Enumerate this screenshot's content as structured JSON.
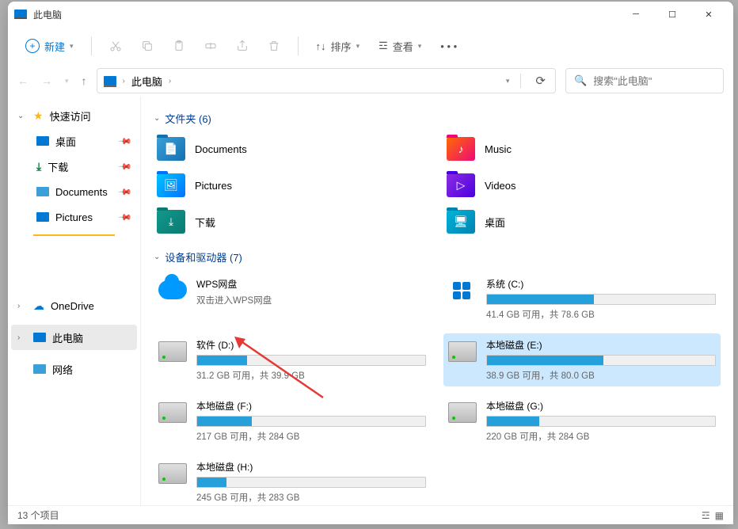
{
  "window": {
    "title": "此电脑"
  },
  "toolbar": {
    "new_label": "新建",
    "sort_label": "排序",
    "view_label": "查看"
  },
  "breadcrumb": {
    "location": "此电脑"
  },
  "search": {
    "placeholder": "搜索\"此电脑\""
  },
  "sidebar": {
    "quick_access": "快速访问",
    "items": [
      {
        "label": "桌面"
      },
      {
        "label": "下载"
      },
      {
        "label": "Documents"
      },
      {
        "label": "Pictures"
      }
    ],
    "onedrive": "OneDrive",
    "this_pc": "此电脑",
    "network": "网络"
  },
  "sections": {
    "folders_header": "文件夹 (6)",
    "drives_header": "设备和驱动器 (7)"
  },
  "folders": [
    {
      "label": "Documents"
    },
    {
      "label": "Music"
    },
    {
      "label": "Pictures"
    },
    {
      "label": "Videos"
    },
    {
      "label": "下载"
    },
    {
      "label": "桌面"
    }
  ],
  "drives": {
    "wps": {
      "name": "WPS网盘",
      "hint": "双击进入WPS网盘"
    },
    "c": {
      "name": "系统 (C:)",
      "status": "41.4 GB 可用，共 78.6 GB",
      "fill": 47
    },
    "d": {
      "name": "软件 (D:)",
      "status": "31.2 GB 可用，共 39.9 GB",
      "fill": 22
    },
    "e": {
      "name": "本地磁盘 (E:)",
      "status": "38.9 GB 可用，共 80.0 GB",
      "fill": 51
    },
    "f": {
      "name": "本地磁盘 (F:)",
      "status": "217 GB 可用，共 284 GB",
      "fill": 24
    },
    "g": {
      "name": "本地磁盘 (G:)",
      "status": "220 GB 可用，共 284 GB",
      "fill": 23
    },
    "h": {
      "name": "本地磁盘 (H:)",
      "status": "245 GB 可用，共 283 GB",
      "fill": 13
    }
  },
  "statusbar": {
    "count": "13 个项目"
  }
}
